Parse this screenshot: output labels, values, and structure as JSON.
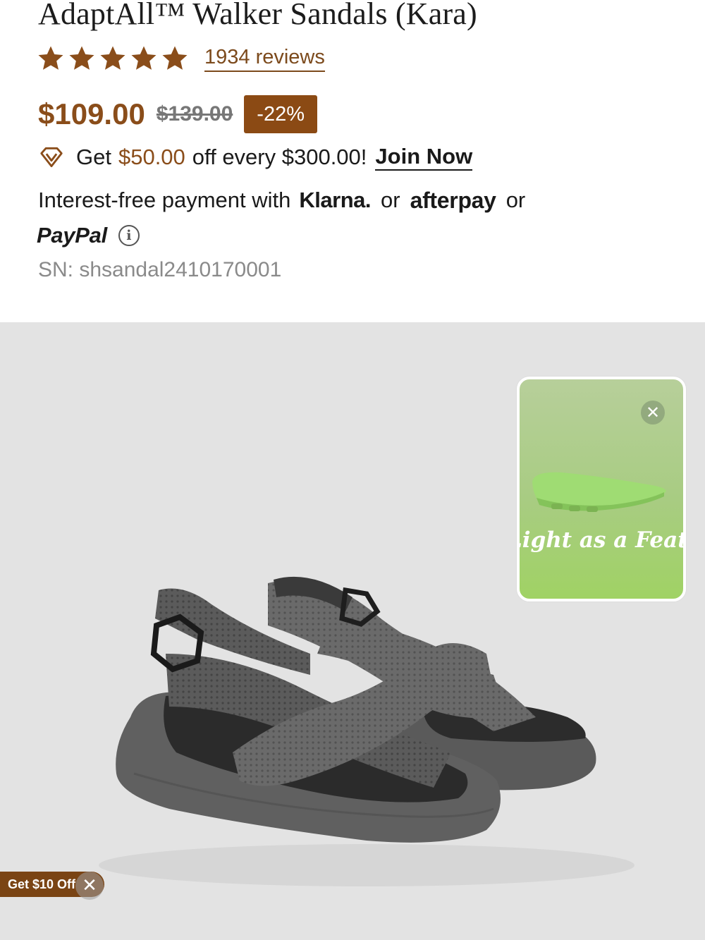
{
  "product": {
    "title": "AdaptAll™ Walker Sandals (Kara)",
    "rating_stars": 5,
    "reviews": "1934 reviews",
    "price": "$109.00",
    "original_price": "$139.00",
    "discount": "-22%",
    "sku": "SN: shsandal2410170001"
  },
  "promo": {
    "prefix": "Get",
    "amount": "$50.00",
    "suffix": "off every $300.00!",
    "join_label": "Join Now"
  },
  "payment": {
    "prefix": "Interest-free payment with",
    "klarna": "Klarna.",
    "or1": "or",
    "afterpay": "afterpay",
    "or2": "or",
    "paypal": "PayPal"
  },
  "video_popup": {
    "caption": "Light as a Feather"
  },
  "coupon": {
    "label": "Get $10 Off"
  },
  "colors": {
    "accent_brown": "#8a4d1a",
    "badge_brown": "#8b4a14",
    "image_bg": "#e3e3e3"
  },
  "icons": {
    "star": "star-icon",
    "diamond": "diamond-icon",
    "info": "info-icon",
    "close": "close-icon"
  }
}
